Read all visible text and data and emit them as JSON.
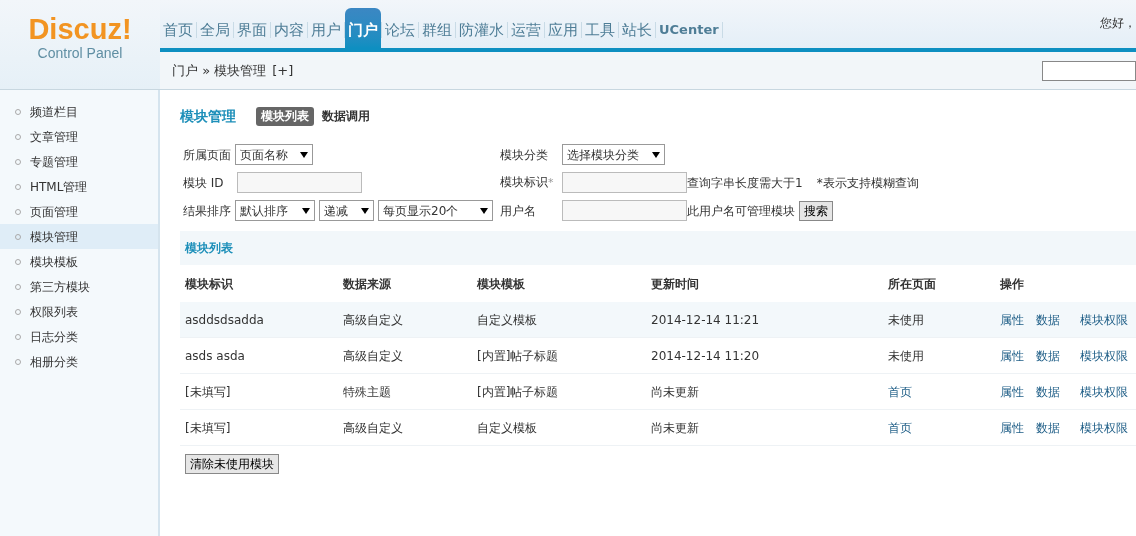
{
  "logo": {
    "brand": "Discuz!",
    "subtitle": "Control Panel"
  },
  "nav": [
    {
      "label": "首页",
      "selected": false
    },
    {
      "label": "全局",
      "selected": false
    },
    {
      "label": "界面",
      "selected": false
    },
    {
      "label": "内容",
      "selected": false
    },
    {
      "label": "用户",
      "selected": false
    },
    {
      "label": "门户",
      "selected": true
    },
    {
      "label": "论坛",
      "selected": false
    },
    {
      "label": "群组",
      "selected": false
    },
    {
      "label": "防灌水",
      "selected": false
    },
    {
      "label": "运营",
      "selected": false
    },
    {
      "label": "应用",
      "selected": false
    },
    {
      "label": "工具",
      "selected": false
    },
    {
      "label": "站长",
      "selected": false
    },
    {
      "label": "UCenter",
      "selected": false
    }
  ],
  "greeting": "您好，",
  "breadcrumb": {
    "path": "门户 » 模块管理",
    "add": "[+]"
  },
  "sidebar": {
    "items": [
      {
        "label": "频道栏目",
        "selected": false
      },
      {
        "label": "文章管理",
        "selected": false
      },
      {
        "label": "专题管理",
        "selected": false
      },
      {
        "label": "HTML管理",
        "selected": false
      },
      {
        "label": "页面管理",
        "selected": false
      },
      {
        "label": "模块管理",
        "selected": true
      },
      {
        "label": "模块模板",
        "selected": false
      },
      {
        "label": "第三方模块",
        "selected": false
      },
      {
        "label": "权限列表",
        "selected": false
      },
      {
        "label": "日志分类",
        "selected": false
      },
      {
        "label": "相册分类",
        "selected": false
      }
    ]
  },
  "page": {
    "title": "模块管理",
    "tabs": [
      {
        "label": "模块列表",
        "selected": true
      },
      {
        "label": "数据调用",
        "selected": false
      }
    ]
  },
  "filters": {
    "page_label": "所属页面",
    "page_select": "页面名称",
    "category_label": "模块分类",
    "category_select": "选择模块分类",
    "id_label": "模块 ID",
    "ident_label": "模块标识",
    "ident_mark": "*",
    "ident_hint": "查询字串长度需大于1",
    "fuzzy_hint": "*表示支持模糊查询",
    "sort_label": "结果排序",
    "sort_select": "默认排序",
    "order_select": "递减",
    "perpage_select": "每页显示20个",
    "user_label": "用户名",
    "user_hint": "此用户名可管理模块",
    "search_button": "搜索"
  },
  "table": {
    "title": "模块列表",
    "columns": [
      "模块标识",
      "数据来源",
      "模块模板",
      "更新时间",
      "所在页面",
      "操作"
    ],
    "rows": [
      {
        "ident": "asddsdsadda",
        "source": "高级自定义",
        "template": "自定义模板",
        "updated": "2014-12-14 11:21",
        "page": "未使用",
        "page_link": false,
        "actions": [
          "属性",
          "数据",
          "模块权限"
        ]
      },
      {
        "ident": "asds asda",
        "source": "高级自定义",
        "template": "[内置]帖子标题",
        "updated": "2014-12-14 11:20",
        "page": "未使用",
        "page_link": false,
        "actions": [
          "属性",
          "数据",
          "模块权限"
        ]
      },
      {
        "ident": "[未填写]",
        "source": "特殊主题",
        "template": "[内置]帖子标题",
        "updated": "尚未更新",
        "page": "首页",
        "page_link": true,
        "actions": [
          "属性",
          "数据",
          "模块权限"
        ]
      },
      {
        "ident": "[未填写]",
        "source": "高级自定义",
        "template": "自定义模板",
        "updated": "尚未更新",
        "page": "首页",
        "page_link": true,
        "actions": [
          "属性",
          "数据",
          "模块权限"
        ]
      }
    ]
  },
  "clear_button": "清除未使用模块"
}
